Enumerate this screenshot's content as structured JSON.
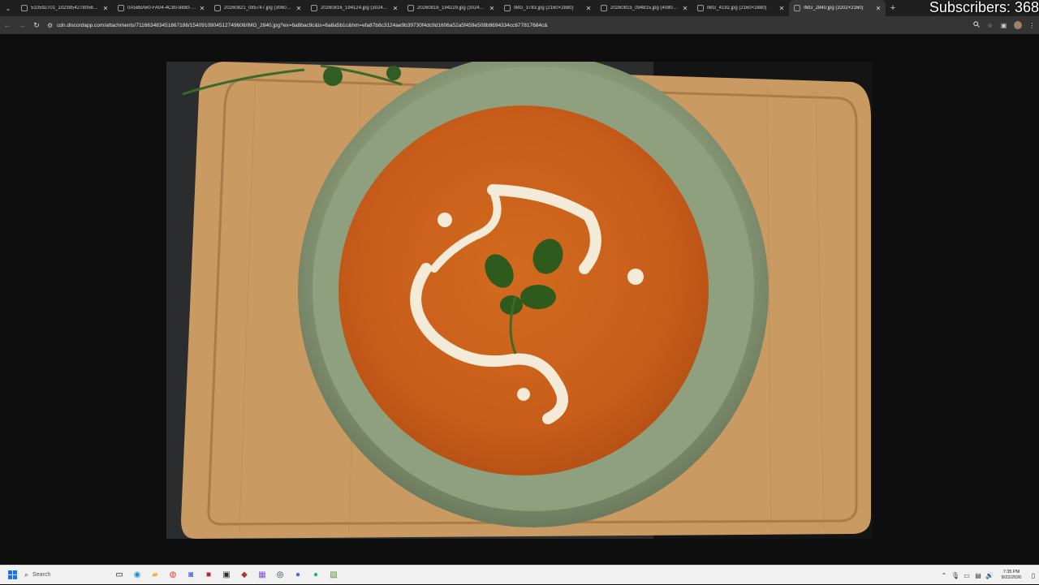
{
  "browser": {
    "tabs": [
      {
        "title": "510592701_1023854278056677..."
      },
      {
        "title": "0A58BA60-FA04-4C80-8880-9..."
      },
      {
        "title": "20260821_085747.jpg (3060×4..."
      },
      {
        "title": "20260816_194124.jpg (3024×4..."
      },
      {
        "title": "20260816_194229.jpg (3024×4..."
      },
      {
        "title": "IMG_3783.jpg (2160×2880)"
      },
      {
        "title": "20260815_094815.jpg (4080×3..."
      },
      {
        "title": "IMG_4192.jpg (2160×2880)"
      },
      {
        "title": "IMG_2840.jpg (3202×2160)"
      }
    ],
    "url": "cdn.discordapp.com/attachments/711663483451867186/1540910904512749608/IMG_2840.jpg?ex=6a8bac9c&is=6a8a5b1c&hm=efa87b8c3124ae9b39730f4dc9d1606a52a5f459e508b8694334cc677817684c&",
    "overlay_text": "Subscribers: 368"
  },
  "taskbar": {
    "search_placeholder": "Search",
    "time": "7:35 PM",
    "date": "8/22/2026"
  },
  "colors": {
    "accent": "#4a90e2"
  }
}
